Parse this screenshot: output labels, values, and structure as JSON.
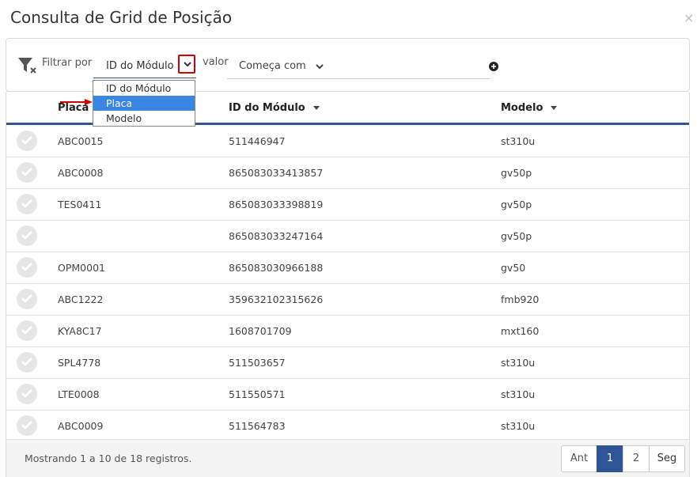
{
  "dialog": {
    "title": "Consulta de Grid de Posição",
    "close": "×"
  },
  "filter": {
    "label": "Filtrar por",
    "field_value": "ID do Módulo",
    "value_label": "valor",
    "condition_value": "Começa com",
    "dropdown_options": [
      "ID do Módulo",
      "Placa",
      "Modelo"
    ],
    "dropdown_selected": "Placa"
  },
  "table": {
    "headers": [
      "Placa",
      "ID do Módulo",
      "Modelo"
    ],
    "rows": [
      [
        "ABC0015",
        "511446947",
        "st310u"
      ],
      [
        "ABC0008",
        "865083033413857",
        "gv50p"
      ],
      [
        "TES0411",
        "865083033398819",
        "gv50p"
      ],
      [
        "",
        "865083033247164",
        "gv50p"
      ],
      [
        "OPM0001",
        "865083030966188",
        "gv50"
      ],
      [
        "ABC1222",
        "359632102315626",
        "fmb920"
      ],
      [
        "KYA8C17",
        "1608701709",
        "mxt160"
      ],
      [
        "SPL4778",
        "511503657",
        "st310u"
      ],
      [
        "LTE0008",
        "511550571",
        "st310u"
      ],
      [
        "ABC0009",
        "511564783",
        "st310u"
      ]
    ]
  },
  "footer": {
    "info": "Mostrando 1 a 10 de 18 registros.",
    "prev": "Ant",
    "pages": [
      "1",
      "2"
    ],
    "next": "Seg"
  },
  "colors": {
    "accent": "#2f5597",
    "highlight": "#3a86e0",
    "annotation": "#d00000"
  }
}
